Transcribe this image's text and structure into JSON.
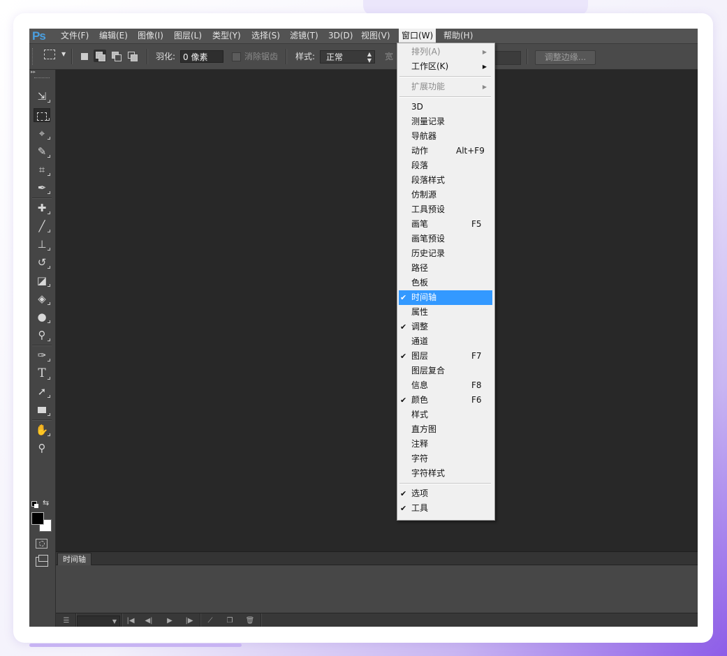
{
  "app": {
    "logo": "Ps"
  },
  "menubar": {
    "items": [
      {
        "label": "文件(F)"
      },
      {
        "label": "编辑(E)"
      },
      {
        "label": "图像(I)"
      },
      {
        "label": "图层(L)"
      },
      {
        "label": "类型(Y)"
      },
      {
        "label": "选择(S)"
      },
      {
        "label": "滤镜(T)"
      },
      {
        "label": "3D(D)"
      },
      {
        "label": "视图(V)"
      },
      {
        "label": "窗口(W)",
        "active": true
      },
      {
        "label": "帮助(H)"
      }
    ]
  },
  "options_bar": {
    "feather_label": "羽化:",
    "feather_value": "0 像素",
    "anti_alias_label": "消除锯齿",
    "style_label": "样式:",
    "style_value": "正常",
    "width_label_partial": "宽",
    "refine_edge_label": "调整边缘..."
  },
  "toolbox": {
    "tools": [
      "move-tool",
      "rectangular-marquee-tool",
      "lasso-tool",
      "quick-selection-tool",
      "crop-tool",
      "eyedropper-tool",
      "spot-healing-brush-tool",
      "brush-tool",
      "clone-stamp-tool",
      "history-brush-tool",
      "eraser-tool",
      "paint-bucket-tool",
      "blur-tool",
      "dodge-tool",
      "pen-tool",
      "type-tool",
      "path-selection-tool",
      "rectangle-tool",
      "hand-tool",
      "zoom-tool"
    ],
    "type_tool_glyph": "T",
    "foreground_color": "#000000",
    "background_color": "#ffffff"
  },
  "timeline_panel": {
    "tab_label": "时间轴"
  },
  "window_menu": {
    "items": [
      {
        "label": "排列(A)",
        "disabled": true,
        "submenu": true
      },
      {
        "label": "工作区(K)",
        "submenu": true
      },
      {
        "label": "扩展功能",
        "disabled": true,
        "submenu": true
      },
      {
        "label": "3D"
      },
      {
        "label": "测量记录"
      },
      {
        "label": "导航器"
      },
      {
        "label": "动作",
        "shortcut": "Alt+F9"
      },
      {
        "label": "段落"
      },
      {
        "label": "段落样式"
      },
      {
        "label": "仿制源"
      },
      {
        "label": "工具预设"
      },
      {
        "label": "画笔",
        "shortcut": "F5"
      },
      {
        "label": "画笔预设"
      },
      {
        "label": "历史记录"
      },
      {
        "label": "路径"
      },
      {
        "label": "色板"
      },
      {
        "label": "时间轴",
        "checked": true,
        "highlighted": true
      },
      {
        "label": "属性"
      },
      {
        "label": "调整",
        "checked": true
      },
      {
        "label": "通道"
      },
      {
        "label": "图层",
        "checked": true,
        "shortcut": "F7"
      },
      {
        "label": "图层复合"
      },
      {
        "label": "信息",
        "shortcut": "F8"
      },
      {
        "label": "颜色",
        "checked": true,
        "shortcut": "F6"
      },
      {
        "label": "样式"
      },
      {
        "label": "直方图"
      },
      {
        "label": "注释"
      },
      {
        "label": "字符"
      },
      {
        "label": "字符样式"
      },
      {
        "label": "选项",
        "checked": true
      },
      {
        "label": "工具",
        "checked": true
      }
    ],
    "check_glyph": "✔",
    "submenu_glyph": "▶"
  },
  "colors": {
    "highlight": "#3399ff",
    "menubar": "#535353",
    "canvas": "#282828"
  }
}
